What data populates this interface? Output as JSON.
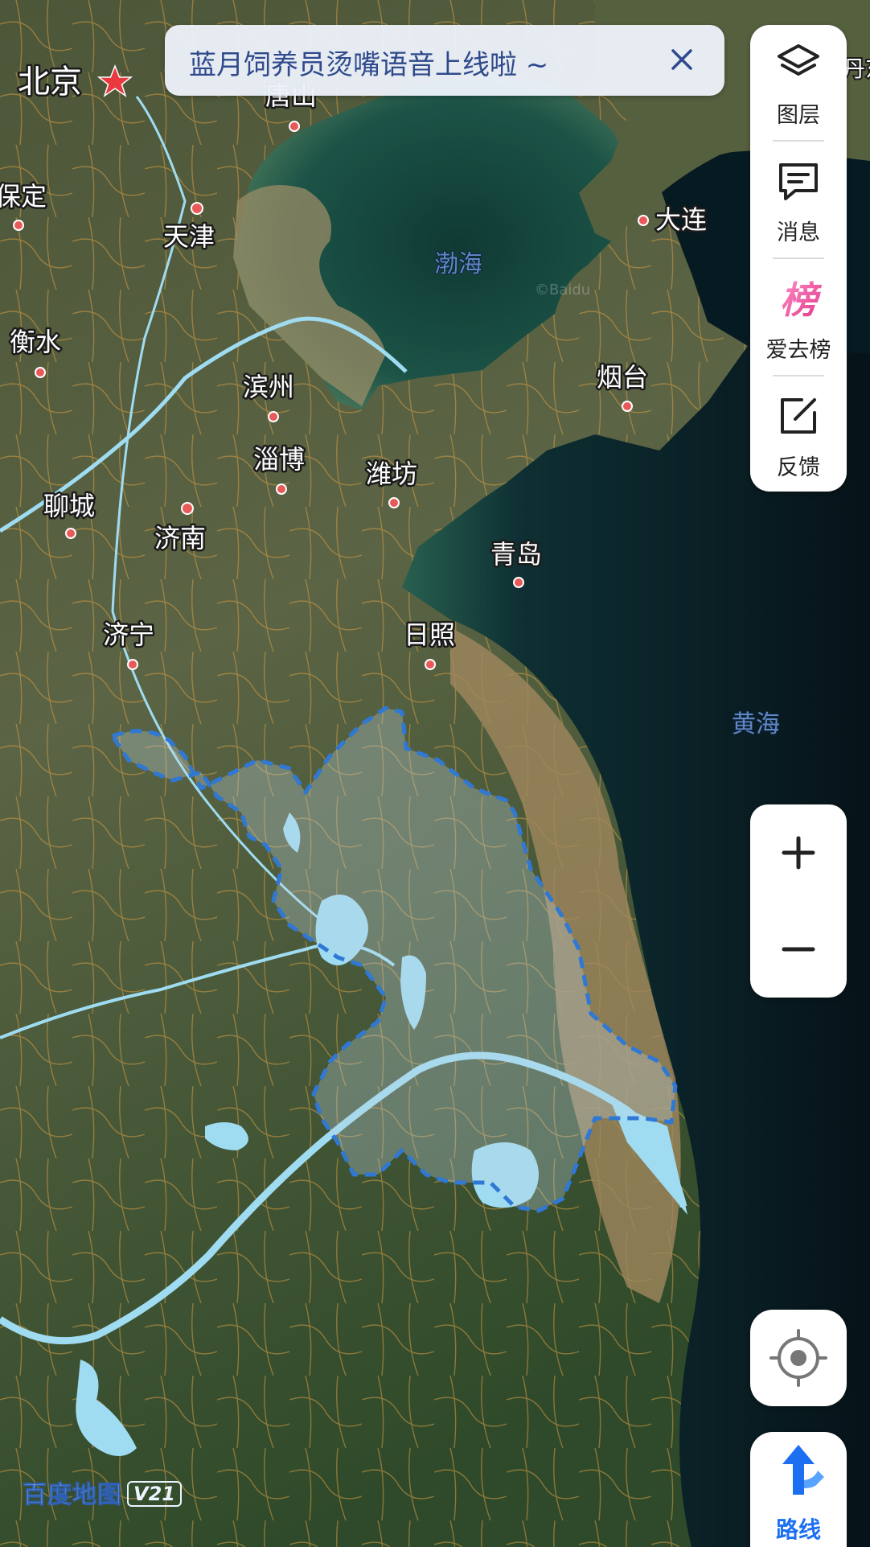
{
  "map": {
    "cities": [
      {
        "id": "beijing",
        "name": "北京",
        "capital": true
      },
      {
        "id": "tangshan",
        "name": "唐山"
      },
      {
        "id": "baoding",
        "name": "保定"
      },
      {
        "id": "tianjin",
        "name": "天津"
      },
      {
        "id": "dalian",
        "name": "大连"
      },
      {
        "id": "hengshui",
        "name": "衡水"
      },
      {
        "id": "binzhou",
        "name": "滨州"
      },
      {
        "id": "yantai",
        "name": "烟台"
      },
      {
        "id": "zibo",
        "name": "淄博"
      },
      {
        "id": "weifang",
        "name": "潍坊"
      },
      {
        "id": "liaocheng",
        "name": "聊城"
      },
      {
        "id": "jinan",
        "name": "济南"
      },
      {
        "id": "qingdao",
        "name": "青岛"
      },
      {
        "id": "jining",
        "name": "济宁"
      },
      {
        "id": "rizhao",
        "name": "日照"
      }
    ],
    "seas": [
      {
        "id": "bohai",
        "name": "渤海"
      },
      {
        "id": "huanghai",
        "name": "黄海"
      }
    ],
    "partial_label": "丹东",
    "watermark": "©Baidu",
    "colors": {
      "land": "#4b5a38",
      "sea": "#0b1e26",
      "river": "#9fdcf2",
      "highlight_border": "#2f78d4",
      "roads": "#d99a3d"
    }
  },
  "banner": {
    "text": "蓝月饲养员烫嘴语音上线啦 ~",
    "close_icon": "close-icon"
  },
  "side_panel": [
    {
      "label": "图层",
      "icon": "layers-icon"
    },
    {
      "label": "消息",
      "icon": "message-icon"
    },
    {
      "label": "爱去榜",
      "icon": "ranking-badge-icon",
      "badge_text": "榜"
    },
    {
      "label": "反馈",
      "icon": "feedback-icon"
    }
  ],
  "zoom": {
    "in": "+",
    "out": "−"
  },
  "route": {
    "label": "路线",
    "icon": "route-arrow-icon"
  },
  "brand": {
    "name": "百度地图",
    "version": "V21"
  }
}
